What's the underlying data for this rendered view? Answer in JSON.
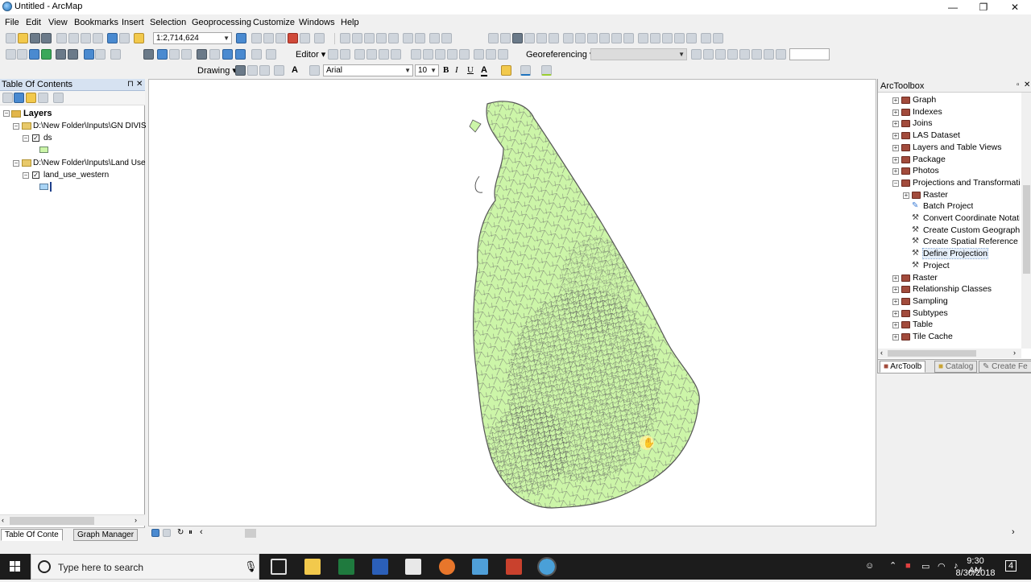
{
  "window": {
    "title": "Untitled - ArcMap",
    "controls": [
      "—",
      "❐",
      "✕"
    ]
  },
  "menu": [
    "File",
    "Edit",
    "View",
    "Bookmarks",
    "Insert",
    "Selection",
    "Geoprocessing",
    "Customize",
    "Windows",
    "Help"
  ],
  "toolbar": {
    "scale": "1:2,714,624",
    "editor_label": "Editor",
    "georef_label": "Georeferencing",
    "drawing_label": "Drawing",
    "font_name": "Arial",
    "font_size": "10",
    "bold": "B",
    "italic": "I",
    "underline": "U",
    "text_tool": "A"
  },
  "toc": {
    "title": "Table Of Contents",
    "pin": "⊓",
    "close": "✕",
    "root": "Layers",
    "group1": "D:\\New Folder\\Inputs\\GN DIVIS",
    "layer1": "ds",
    "group2": "D:\\New Folder\\Inputs\\Land Use",
    "layer2": "land_use_western",
    "tabs": [
      "Table Of Conte",
      "Graph Manager"
    ]
  },
  "toolbox": {
    "title": "ArcToolbox",
    "items": [
      {
        "label": "Graph",
        "type": "toolset",
        "level": 0
      },
      {
        "label": "Indexes",
        "type": "toolset",
        "level": 0
      },
      {
        "label": "Joins",
        "type": "toolset",
        "level": 0
      },
      {
        "label": "LAS Dataset",
        "type": "toolset",
        "level": 0
      },
      {
        "label": "Layers and Table Views",
        "type": "toolset",
        "level": 0
      },
      {
        "label": "Package",
        "type": "toolset",
        "level": 0
      },
      {
        "label": "Photos",
        "type": "toolset",
        "level": 0
      },
      {
        "label": "Projections and Transformations",
        "type": "toolset-open",
        "level": 0
      },
      {
        "label": "Raster",
        "type": "toolset",
        "level": 1
      },
      {
        "label": "Batch Project",
        "type": "script",
        "level": 1
      },
      {
        "label": "Convert Coordinate Notation",
        "type": "tool",
        "level": 1
      },
      {
        "label": "Create Custom Geographic Transformation",
        "type": "tool",
        "level": 1
      },
      {
        "label": "Create Spatial Reference",
        "type": "tool",
        "level": 1
      },
      {
        "label": "Define Projection",
        "type": "tool",
        "level": 1,
        "selected": true
      },
      {
        "label": "Project",
        "type": "tool",
        "level": 1
      },
      {
        "label": "Raster",
        "type": "toolset",
        "level": 0
      },
      {
        "label": "Relationship Classes",
        "type": "toolset",
        "level": 0
      },
      {
        "label": "Sampling",
        "type": "toolset",
        "level": 0
      },
      {
        "label": "Subtypes",
        "type": "toolset",
        "level": 0
      },
      {
        "label": "Table",
        "type": "toolset",
        "level": 0
      },
      {
        "label": "Tile Cache",
        "type": "toolset",
        "level": 0
      }
    ],
    "tabs": [
      "ArcToolb",
      "Catalog",
      "Create Fe"
    ]
  },
  "taskbar": {
    "search_placeholder": "Type here to search",
    "time": "9:30 AM",
    "date": "8/30/2018",
    "notifications": "4"
  },
  "colors": {
    "land_fill": "#ccf5a8",
    "boundary": "#555555",
    "accent_blue": "#1e73be"
  }
}
